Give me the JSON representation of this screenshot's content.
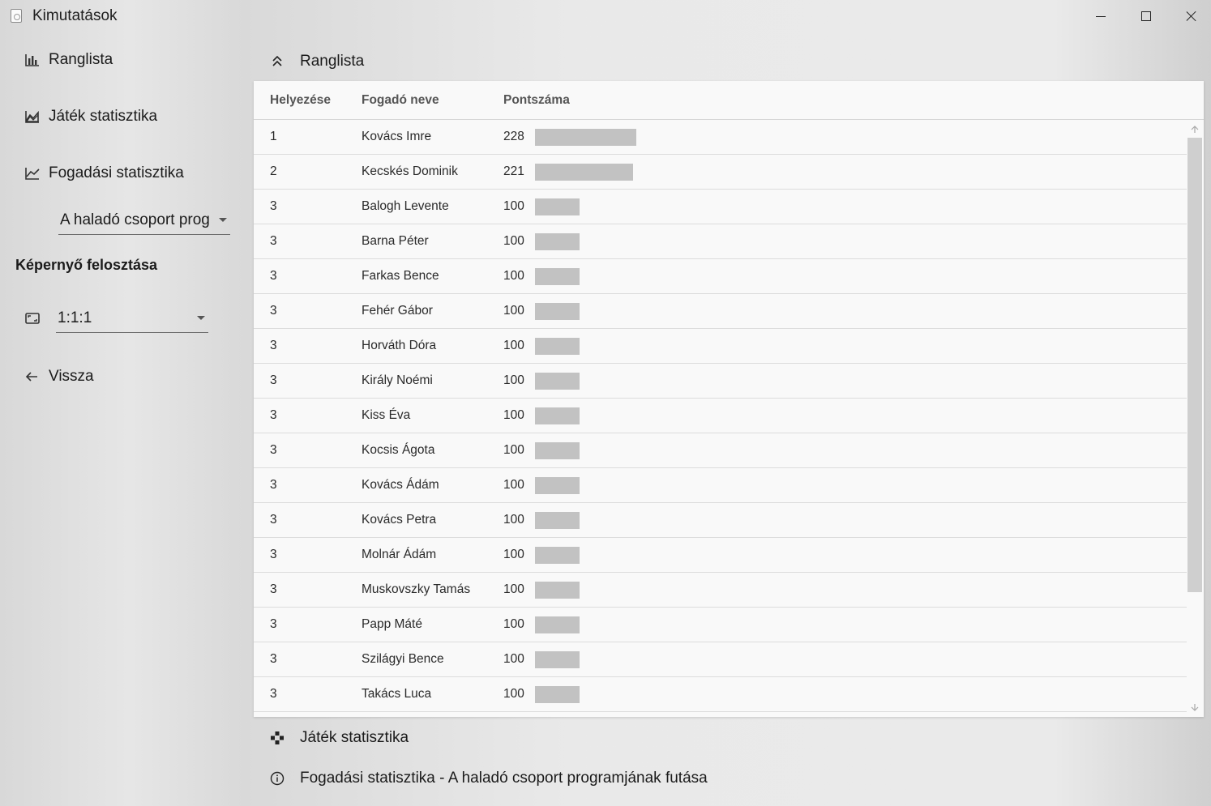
{
  "window": {
    "title": "Kimutatások",
    "icon": "app-icon",
    "controls": [
      "minimize-icon",
      "maximize-icon",
      "close-icon"
    ]
  },
  "sidebar": {
    "items": [
      {
        "label": "Ranglista",
        "icon": "bar-chart-icon"
      },
      {
        "label": "Játék statisztika",
        "icon": "area-chart-icon"
      },
      {
        "label": "Fogadási statisztika",
        "icon": "line-chart-icon"
      }
    ],
    "bet_dropdown": {
      "value": "A haladó csoport prog"
    },
    "layout_section_title": "Képernyő felosztása",
    "layout_dropdown": {
      "value": "1:1:1",
      "icon": "aspect-ratio-icon"
    },
    "back": {
      "label": "Vissza",
      "icon": "arrow-left-icon"
    }
  },
  "main": {
    "ranking_header": {
      "label": "Ranglista",
      "icon": "double-chevron-up-icon"
    },
    "table": {
      "columns": [
        "Helyezése",
        "Fogadó neve",
        "Pontszáma"
      ],
      "max_score": 228,
      "rows": [
        {
          "rank": "1",
          "name": "Kovács Imre",
          "score": 228
        },
        {
          "rank": "2",
          "name": "Kecskés Dominik",
          "score": 221
        },
        {
          "rank": "3",
          "name": "Balogh Levente",
          "score": 100
        },
        {
          "rank": "3",
          "name": "Barna Péter",
          "score": 100
        },
        {
          "rank": "3",
          "name": "Farkas Bence",
          "score": 100
        },
        {
          "rank": "3",
          "name": "Fehér Gábor",
          "score": 100
        },
        {
          "rank": "3",
          "name": "Horváth Dóra",
          "score": 100
        },
        {
          "rank": "3",
          "name": "Király Noémi",
          "score": 100
        },
        {
          "rank": "3",
          "name": "Kiss Éva",
          "score": 100
        },
        {
          "rank": "3",
          "name": "Kocsis Ágota",
          "score": 100
        },
        {
          "rank": "3",
          "name": "Kovács Ádám",
          "score": 100
        },
        {
          "rank": "3",
          "name": "Kovács Petra",
          "score": 100
        },
        {
          "rank": "3",
          "name": "Molnár Ádám",
          "score": 100
        },
        {
          "rank": "3",
          "name": "Muskovszky Tamás",
          "score": 100
        },
        {
          "rank": "3",
          "name": "Papp Máté",
          "score": 100
        },
        {
          "rank": "3",
          "name": "Szilágyi Bence",
          "score": 100
        },
        {
          "rank": "3",
          "name": "Takács Luca",
          "score": 100
        }
      ]
    },
    "game_stats_header": {
      "label": "Játék statisztika",
      "icon": "gamepad-icon"
    },
    "bet_stats_header": {
      "label": "Fogadási statisztika - A haladó csoport programjának futása",
      "icon": "info-icon"
    }
  },
  "colors": {
    "score_bar": "#c2c2c2",
    "panel_bg": "#f9f9f9",
    "text": "#1b1b1b"
  }
}
